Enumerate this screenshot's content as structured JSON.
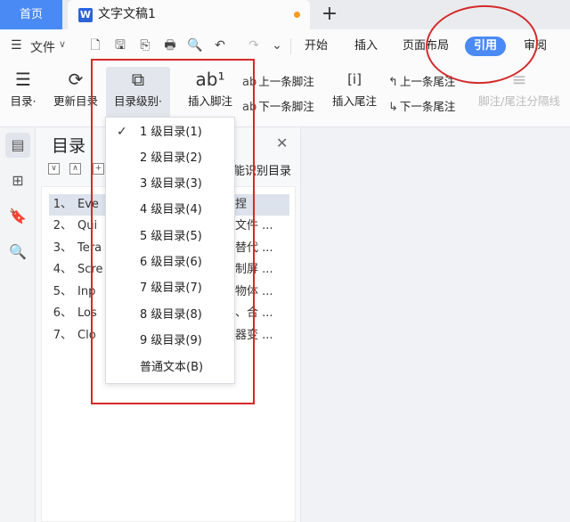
{
  "tabs": {
    "home": "首页",
    "doc_icon": "W",
    "doc_title": "文字文稿1",
    "add": "+"
  },
  "menubar": {
    "hamburger": "☰",
    "file": "文件",
    "file_caret": "∨",
    "quick": [
      "🗋",
      "🖫",
      "⎘",
      "🖶",
      "🔍",
      "↶",
      "↷",
      "⌄"
    ],
    "ribbon_tabs": [
      "开始",
      "插入",
      "页面布局",
      "引用",
      "审阅"
    ],
    "active_tab": "引用"
  },
  "ribbon": {
    "toc": {
      "icon": "☰",
      "label": "目录·"
    },
    "update_toc": {
      "icon": "⟳",
      "label": "更新目录"
    },
    "toc_level": {
      "icon": "⧉",
      "label": "目录级别·"
    },
    "insert_footnote": {
      "icon": "ab¹",
      "label": "插入脚注"
    },
    "prev_footnote": {
      "icon": "ab",
      "label": "上一条脚注"
    },
    "next_footnote": {
      "icon": "ab",
      "label": "下一条脚注"
    },
    "insert_endnote": {
      "icon": "[i]",
      "label": "插入尾注"
    },
    "prev_endnote": {
      "icon": "↰",
      "label": "上一条尾注"
    },
    "next_endnote": {
      "icon": "↳",
      "label": "下一条尾注"
    },
    "separator": {
      "icon": "≡",
      "label": "脚注/尾注分隔线"
    }
  },
  "rail": {
    "icons": [
      "▤",
      "⊞",
      "🔖",
      "🔍"
    ]
  },
  "panel": {
    "title": "目录",
    "close": "✕",
    "collapse": "∨",
    "expand": "∧",
    "add": "+",
    "smart_label": "能识别目录",
    "items": [
      {
        "num": "1、",
        "text": "Eve",
        "tail": "的捏"
      },
      {
        "num": "2、",
        "text": "Qui",
        "tail": "览文件 ..."
      },
      {
        "num": "3、",
        "text": "Tera",
        "tail": "是替代 ..."
      },
      {
        "num": "4、",
        "text": "Scre",
        "tail": "录制屏 ..."
      },
      {
        "num": "5、",
        "text": "Inp",
        "tail": "或物体 ..."
      },
      {
        "num": "6、",
        "text": "Los",
        "tail": "东、合 ..."
      },
      {
        "num": "7、",
        "text": "Clo",
        "tail": "览器变 ..."
      }
    ]
  },
  "dropdown": {
    "checked_index": 0,
    "check_mark": "✓",
    "items": [
      "1 级目录(1)",
      "2 级目录(2)",
      "3 级目录(3)",
      "4 级目录(4)",
      "5 级目录(5)",
      "6 级目录(6)",
      "7 级目录(7)",
      "8 级目录(8)",
      "9 级目录(9)",
      "普通文本(B)"
    ]
  },
  "colors": {
    "accent": "#4a8af4",
    "annotation": "#d42a2a"
  }
}
